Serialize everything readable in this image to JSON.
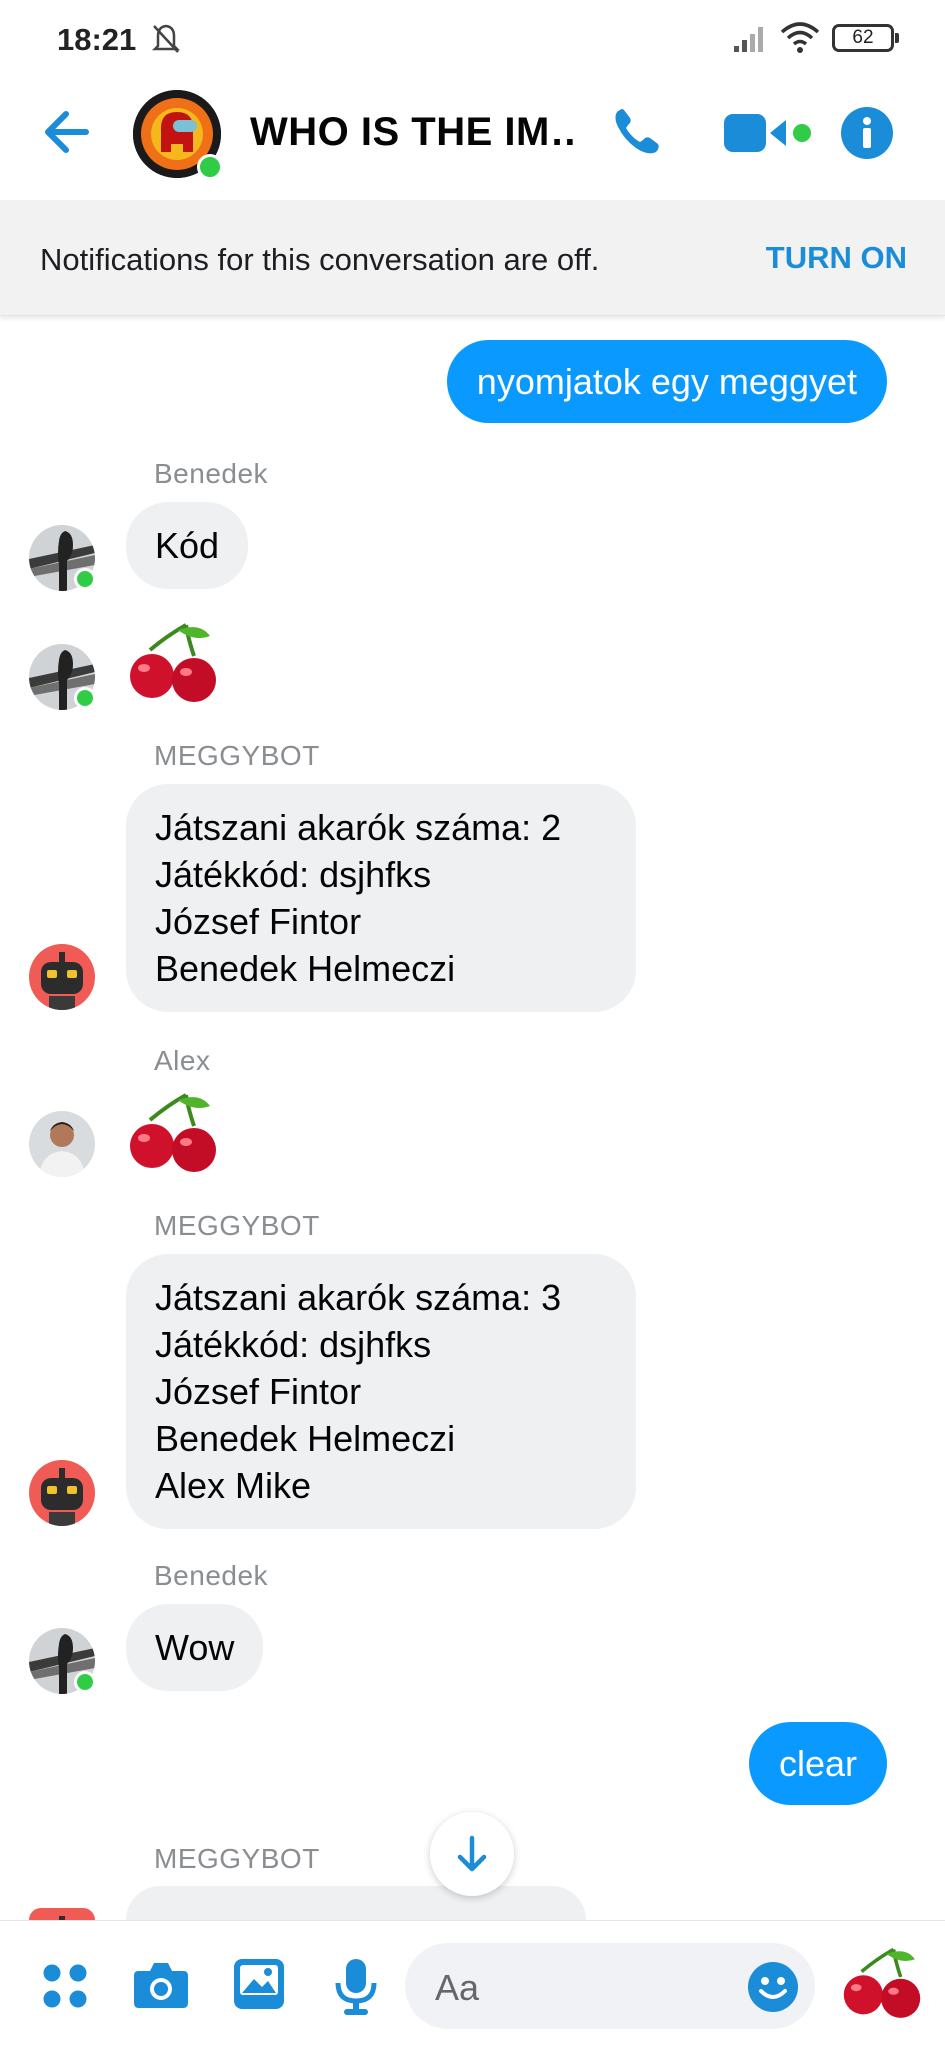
{
  "status_bar": {
    "time": "18:21",
    "battery": "62"
  },
  "header": {
    "title": "WHO IS THE IM…",
    "icons": [
      "back-arrow-icon",
      "phone-icon",
      "video-icon",
      "info-icon"
    ],
    "accent": "#1a8cd8"
  },
  "notification_banner": {
    "text": "Notifications for this conversation are off.",
    "action": "TURN ON"
  },
  "messages": {
    "m1": {
      "text": "nyomjatok egy meggyet",
      "direction": "outgoing"
    },
    "m2": {
      "sender": "Benedek",
      "text": "Kód"
    },
    "m3": {
      "emoji": "cherries"
    },
    "m4": {
      "sender": "MEGGYBOT",
      "lines": [
        "Játszani akarók száma: 2",
        "Játékkód: dsjhfks",
        "József Fintor",
        "Benedek Helmeczi"
      ]
    },
    "m5": {
      "sender": "Alex",
      "emoji": "cherries"
    },
    "m6": {
      "sender": "MEGGYBOT",
      "lines": [
        "Játszani akarók száma: 3",
        "Játékkód: dsjhfks",
        "József Fintor",
        "Benedek Helmeczi",
        "Alex Mike"
      ]
    },
    "m7": {
      "sender": "Benedek",
      "text": "Wow"
    },
    "m8": {
      "text": "clear",
      "direction": "outgoing"
    },
    "m9": {
      "sender": "MEGGYBOT"
    }
  },
  "composer": {
    "placeholder": "Aa",
    "icons": [
      "apps-icon",
      "camera-icon",
      "gallery-icon",
      "mic-icon",
      "emoji-icon",
      "cherries-icon"
    ]
  },
  "colors": {
    "outgoing_bubble": "#0a99ff",
    "incoming_bubble": "#eef0f2",
    "online": "#31cc46"
  }
}
